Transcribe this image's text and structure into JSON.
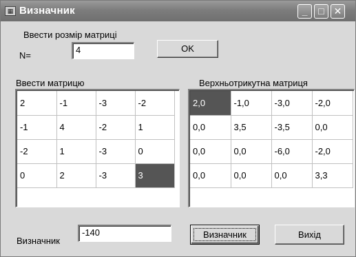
{
  "window": {
    "title": "Визначник",
    "icon": "app-icon"
  },
  "size_section": {
    "label": "Ввести розмір матриці",
    "n_label": "N=",
    "n_value": "4",
    "ok_label": "OK"
  },
  "input_matrix": {
    "label": "Ввести матрицю",
    "rows": [
      [
        "2",
        "-1",
        "-3",
        "-2"
      ],
      [
        "-1",
        "4",
        "-2",
        "1"
      ],
      [
        "-2",
        "1",
        "-3",
        "0"
      ],
      [
        "0",
        "2",
        "-3",
        "3"
      ]
    ]
  },
  "result_matrix": {
    "label": "Верхньотрикутна матриця",
    "rows": [
      [
        "2,0",
        "-1,0",
        "-3,0",
        "-2,0"
      ],
      [
        "0,0",
        "3,5",
        "-3,5",
        "0,0"
      ],
      [
        "0,0",
        "0,0",
        "-6,0",
        "-2,0"
      ],
      [
        "0,0",
        "0,0",
        "0,0",
        "3,3"
      ]
    ]
  },
  "determinant": {
    "label": "Визначник",
    "value": "-140",
    "button_label": "Визначник",
    "exit_label": "Вихід"
  }
}
